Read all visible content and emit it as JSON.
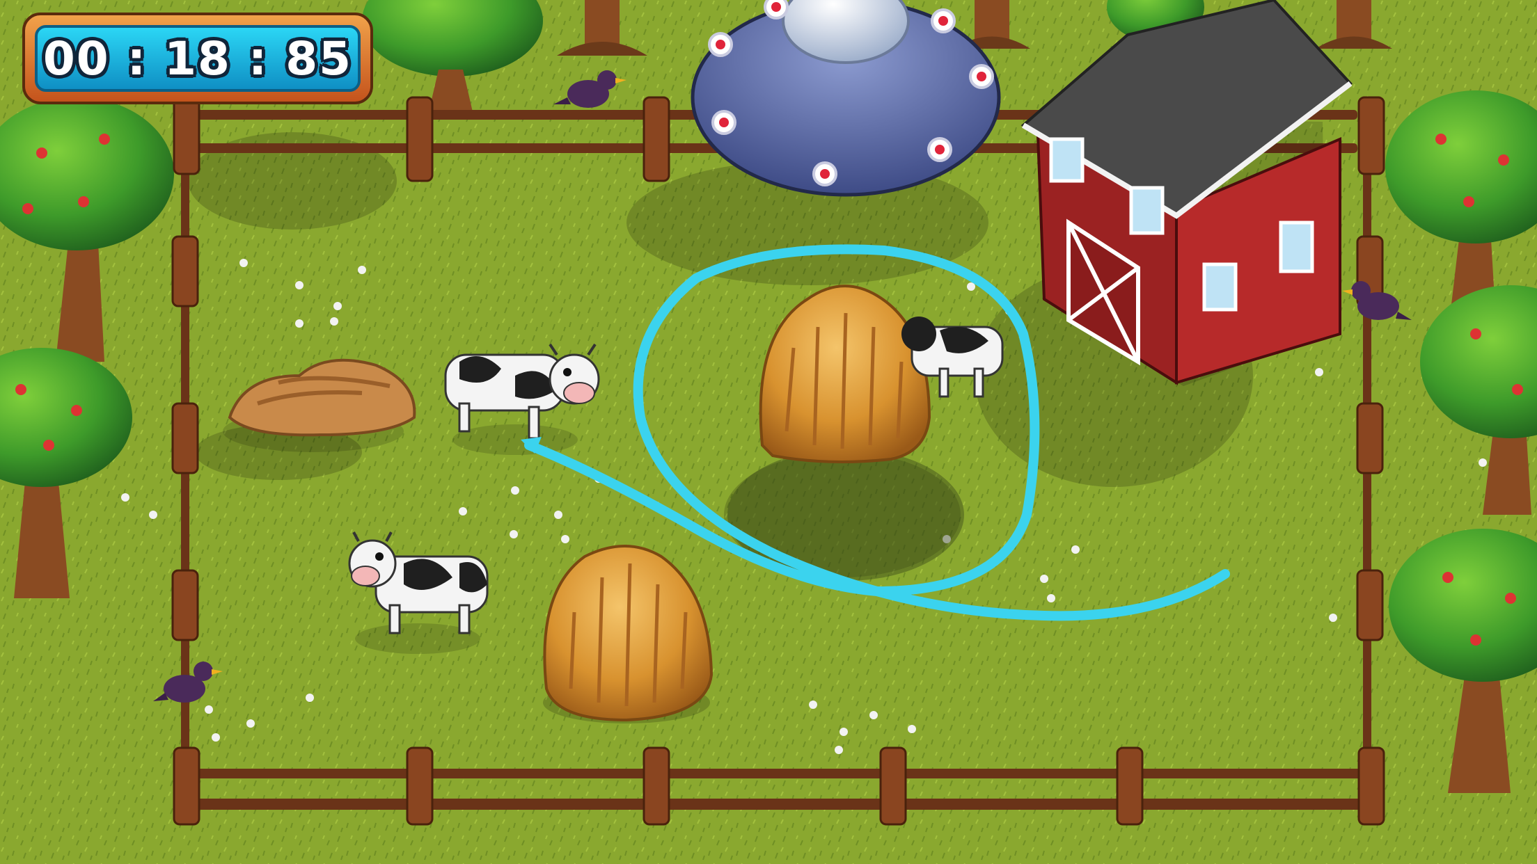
{
  "hud": {
    "timer": "00 : 18 : 85"
  },
  "colors": {
    "grass": "#8aa82f",
    "grass_dark": "#6b8a22",
    "fence": "#6a3318",
    "fence_light": "#9a5a2c",
    "barn_red": "#a52424",
    "lasso": "#3bd3ee",
    "hay": "#d9902f",
    "timer_blue": "#1fb6e3",
    "timer_frame": "#e0782c"
  },
  "icons": {
    "ufo": "ufo-icon",
    "barn": "barn-icon",
    "cow": "cow-icon",
    "haystack": "haystack-icon",
    "tree": "apple-tree-icon",
    "crow": "crow-icon",
    "rock": "rock-icon",
    "flower": "daisy-icon"
  }
}
